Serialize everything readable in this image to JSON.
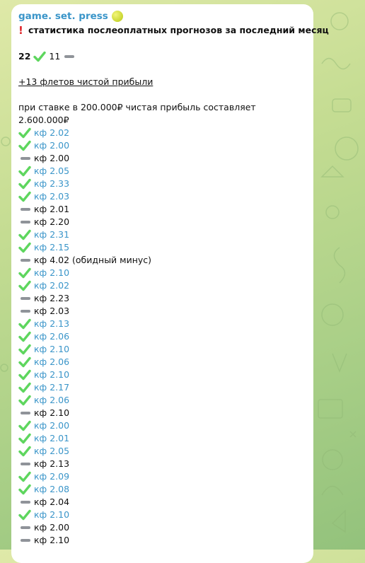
{
  "message": {
    "sender": "game. set. press",
    "headline": "статистика послеоплатных прогнозов за последний месяц",
    "wins_count": "22",
    "losses_count": "11",
    "profit_line": "+13 флетов чистой прибыли",
    "stake_line": "при ставке в 200.000₽ чистая прибыль составляет 2.600.000₽",
    "results": [
      {
        "outcome": "win",
        "text": "кф 2.02"
      },
      {
        "outcome": "win",
        "text": "кф 2.00"
      },
      {
        "outcome": "loss",
        "text": "кф 2.00"
      },
      {
        "outcome": "win",
        "text": "кф 2.05"
      },
      {
        "outcome": "win",
        "text": "кф 2.33"
      },
      {
        "outcome": "win",
        "text": "кф 2.03"
      },
      {
        "outcome": "loss",
        "text": "кф 2.01"
      },
      {
        "outcome": "loss",
        "text": "кф 2.20"
      },
      {
        "outcome": "win",
        "text": "кф 2.31"
      },
      {
        "outcome": "win",
        "text": "кф 2.15"
      },
      {
        "outcome": "loss",
        "text": "кф 4.02 (обидный минус)"
      },
      {
        "outcome": "win",
        "text": "кф 2.10"
      },
      {
        "outcome": "win",
        "text": "кф 2.02"
      },
      {
        "outcome": "loss",
        "text": "кф 2.23"
      },
      {
        "outcome": "loss",
        "text": "кф 2.03"
      },
      {
        "outcome": "win",
        "text": "кф 2.13"
      },
      {
        "outcome": "win",
        "text": "кф 2.06"
      },
      {
        "outcome": "win",
        "text": "кф 2.10"
      },
      {
        "outcome": "win",
        "text": "кф 2.06"
      },
      {
        "outcome": "win",
        "text": "кф 2.10"
      },
      {
        "outcome": "win",
        "text": "кф 2.17"
      },
      {
        "outcome": "win",
        "text": "кф 2.06"
      },
      {
        "outcome": "loss",
        "text": "кф 2.10"
      },
      {
        "outcome": "win",
        "text": "кф 2.00"
      },
      {
        "outcome": "win",
        "text": "кф 2.01"
      },
      {
        "outcome": "win",
        "text": "кф 2.05"
      },
      {
        "outcome": "loss",
        "text": "кф 2.13"
      },
      {
        "outcome": "win",
        "text": "кф 2.09"
      },
      {
        "outcome": "win",
        "text": "кф 2.08"
      },
      {
        "outcome": "loss",
        "text": "кф 2.04"
      },
      {
        "outcome": "win",
        "text": "кф 2.10"
      },
      {
        "outcome": "loss",
        "text": "кф 2.00"
      },
      {
        "outcome": "loss",
        "text": "кф 2.10"
      }
    ]
  },
  "icons": {
    "win": "check-mark-icon",
    "loss": "minus-icon",
    "sender_badge": "tennis-ball-icon",
    "headline_badge": "exclamation-icon"
  },
  "colors": {
    "sender": "#3a95c9",
    "win_text": "#3a95c9",
    "check": "#5ed65e",
    "minus": "#8f9399",
    "exclamation": "#e0262b",
    "background": "#b8d68c"
  }
}
